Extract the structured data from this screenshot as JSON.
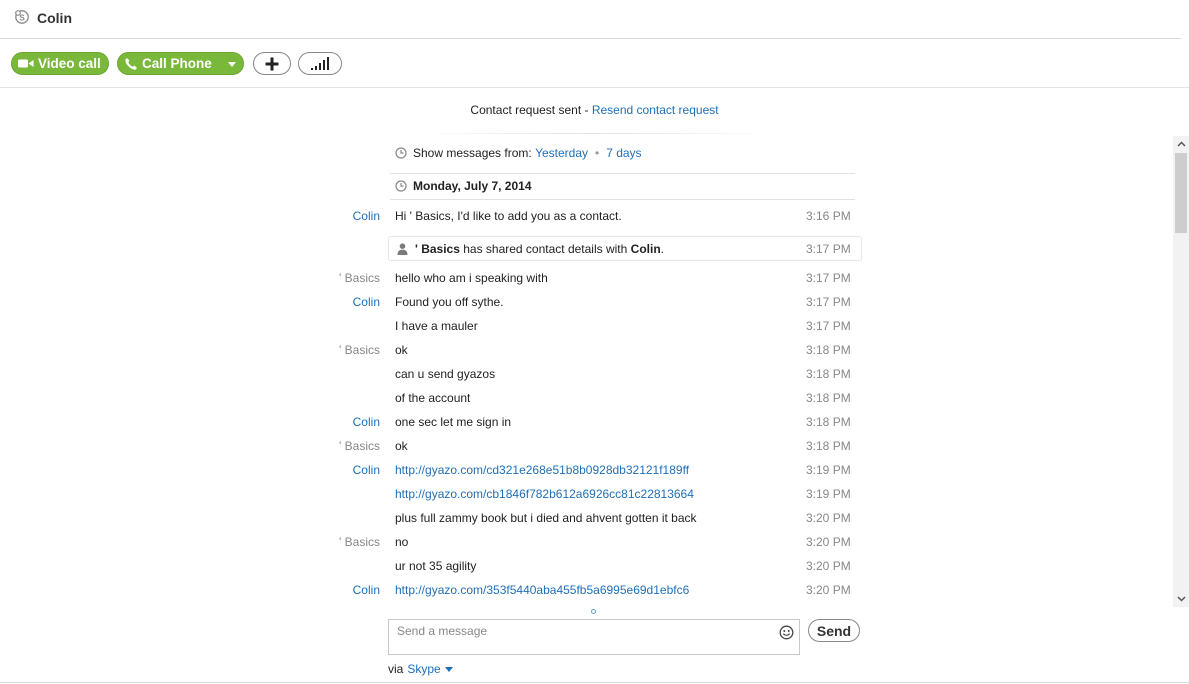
{
  "header": {
    "title": "Colin",
    "icon": "skype-icon"
  },
  "toolbar": {
    "video_call_label": "Video call",
    "call_phone_label": "Call Phone",
    "add_icon": "plus-icon",
    "signal_icon": "signal-icon",
    "accent_color": "#79b83a"
  },
  "contact_request": {
    "text": "Contact request sent - ",
    "link": "Resend contact request"
  },
  "history": {
    "label": "Show messages from:",
    "option_yesterday": "Yesterday",
    "separator": "•",
    "option_7days": "7 days"
  },
  "date_header": "Monday, July 7, 2014",
  "shared": {
    "name": "' Basics",
    "middle": " has shared contact details with ",
    "target": "Colin",
    "end": ".",
    "time": "3:17 PM"
  },
  "messages": [
    {
      "sender": "Colin",
      "text": "Hi ' Basics, I'd like to add you as a contact.",
      "time": "3:16 PM"
    },
    {
      "sender": "' Basics",
      "text": "hello who am i speaking with",
      "time": "3:17 PM"
    },
    {
      "sender": "Colin",
      "text": "Found you off sythe.",
      "time": "3:17 PM"
    },
    {
      "sender": "",
      "text": "I have a mauler",
      "time": "3:17 PM"
    },
    {
      "sender": "' Basics",
      "text": "ok",
      "time": "3:18 PM"
    },
    {
      "sender": "",
      "text": "can u send gyazos",
      "time": "3:18 PM"
    },
    {
      "sender": "",
      "text": "of the account",
      "time": "3:18 PM"
    },
    {
      "sender": "Colin",
      "text": "one sec let me sign in",
      "time": "3:18 PM"
    },
    {
      "sender": "' Basics",
      "text": "ok",
      "time": "3:18 PM"
    },
    {
      "sender": "Colin",
      "text": "http://gyazo.com/cd321e268e51b8b0928db32121f189ff",
      "time": "3:19 PM",
      "is_link": true
    },
    {
      "sender": "",
      "text": "http://gyazo.com/cb1846f782b612a6926cc81c22813664",
      "time": "3:19 PM",
      "is_link": true
    },
    {
      "sender": "",
      "text": "plus full zammy book but i died and ahvent gotten it back",
      "time": "3:20 PM"
    },
    {
      "sender": "' Basics",
      "text": "no",
      "time": "3:20 PM"
    },
    {
      "sender": "",
      "text": "ur not 35 agility",
      "time": "3:20 PM"
    },
    {
      "sender": "Colin",
      "text": "http://gyazo.com/353f5440aba455fb5a6995e69d1ebfc6",
      "time": "3:20 PM",
      "is_link": true
    }
  ],
  "composer": {
    "placeholder": "Send a message",
    "send_label": "Send",
    "emoji_icon": "smile-icon"
  },
  "via": {
    "prefix": "via",
    "service": "Skype"
  }
}
